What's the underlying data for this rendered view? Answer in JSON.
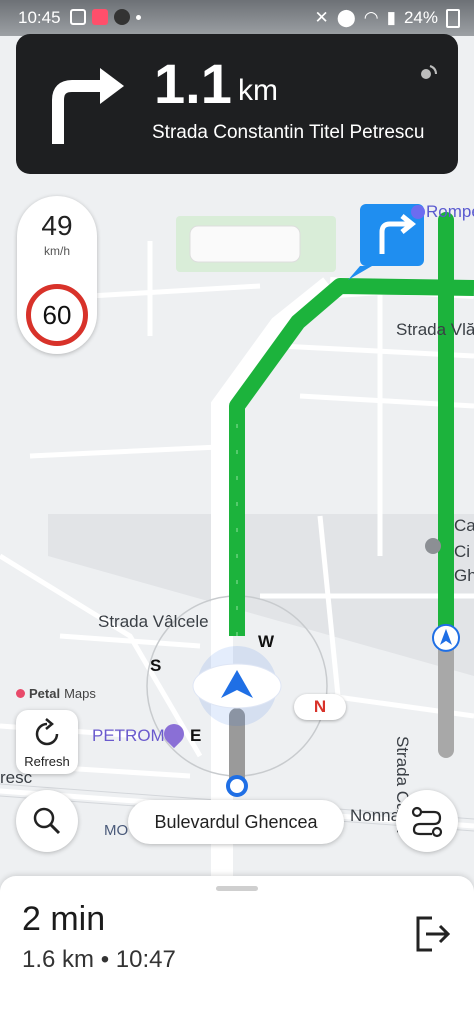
{
  "status_bar": {
    "time": "10:45",
    "battery": "24%"
  },
  "instruction": {
    "distance": "1.1",
    "unit": "km",
    "street": "Strada Constantin Titel Petrescu",
    "turn_icon": "turn-right-arrow-icon"
  },
  "speed": {
    "current": "49",
    "unit": "km/h",
    "limit": "60"
  },
  "map_labels": {
    "rompetrol": "Rompe",
    "strada_vla": "Strada Vlă",
    "strada_valcele": "Strada Vâlcele",
    "petrom": "PETROM",
    "strada_carta": "Strada Carta",
    "mos": "MO",
    "presc": "resc",
    "nonna": "Nonna",
    "ca": "Ca",
    "ci": "Ci",
    "gh": "Gh",
    "brand_logo": "Petal",
    "brand_maps": "Maps"
  },
  "compass": {
    "north": "N",
    "south": "S",
    "east": "E",
    "west": "W"
  },
  "controls": {
    "refresh_label": "Refresh"
  },
  "current_road": "Bulevardul Ghencea",
  "route_progress": 0.22,
  "eta": {
    "duration": "2 min",
    "distance": "1.6 km",
    "separator": "•",
    "arrival": "10:47"
  },
  "colors": {
    "route": "#1cb33c",
    "accent_blue": "#1f6fe5",
    "banner_bg": "#1e1f21",
    "speed_limit_ring": "#d8322a"
  }
}
